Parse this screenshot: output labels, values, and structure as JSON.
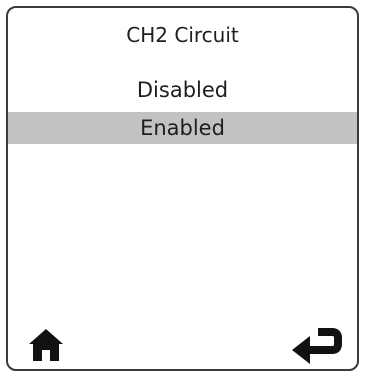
{
  "screen": {
    "title": "CH2 Circuit",
    "options": [
      {
        "label": "Disabled",
        "selected": false
      },
      {
        "label": "Enabled",
        "selected": true
      }
    ]
  },
  "nav": {
    "home_icon": "home-icon",
    "back_icon": "return-arrow-icon"
  },
  "colors": {
    "border": "#3a3a3a",
    "selection": "#c2c2c2",
    "text": "#1e1e1e",
    "icon": "#111111"
  }
}
